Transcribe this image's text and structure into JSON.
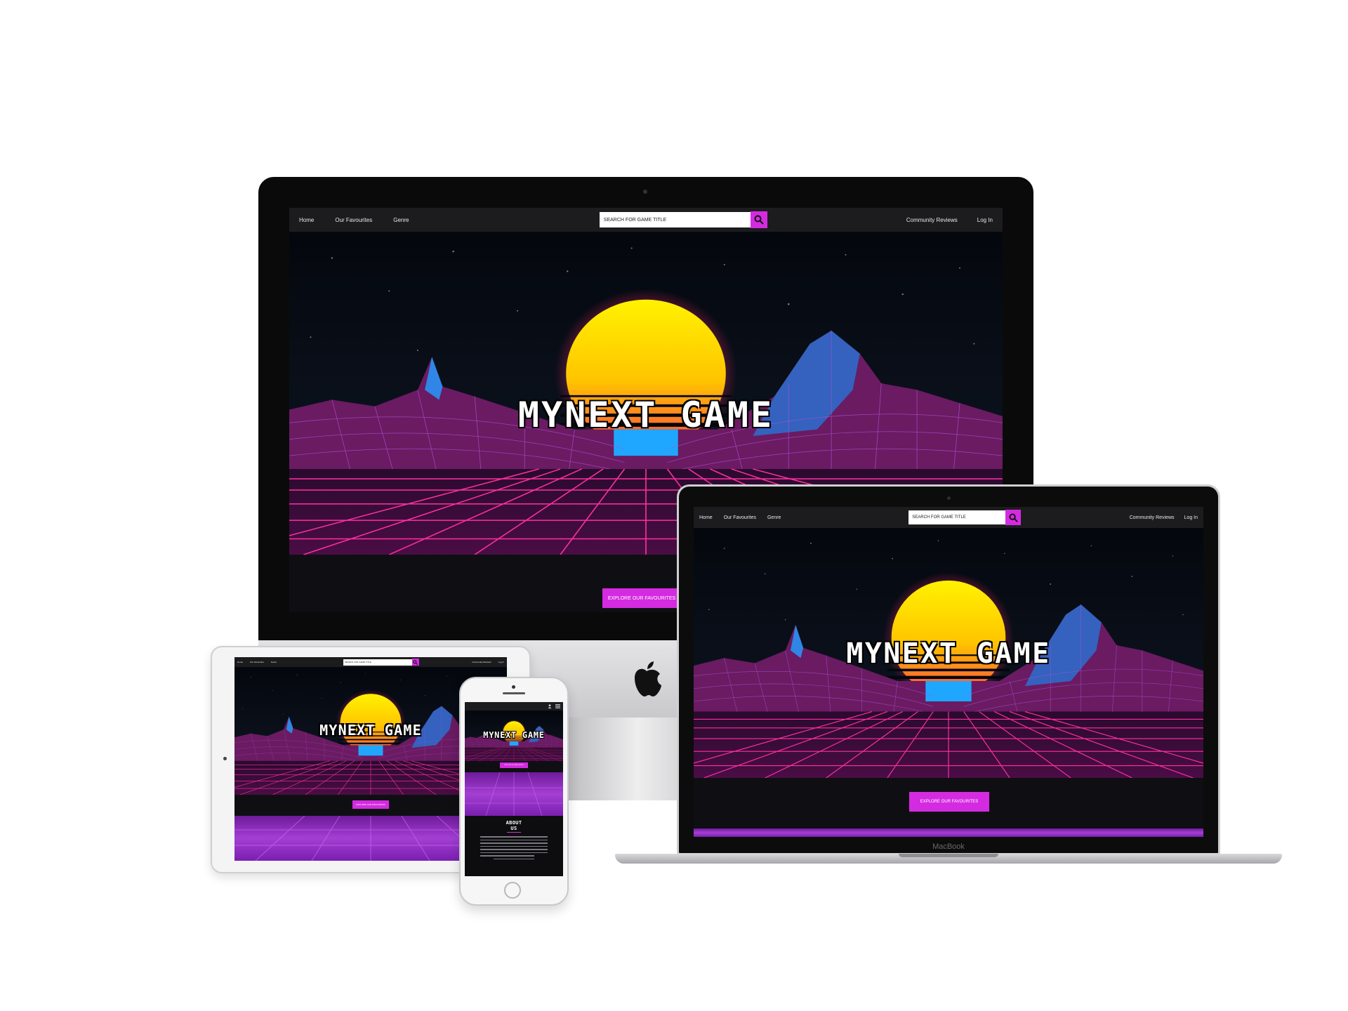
{
  "site": {
    "nav": {
      "home": "Home",
      "favourites": "Our Favourites",
      "genre": "Genre",
      "community": "Community Reviews",
      "login": "Log In"
    },
    "search": {
      "placeholder": "SEARCH FOR GAME TITLE"
    },
    "hero": {
      "title": "MYNEXT GAME"
    },
    "cta": "EXPLORE OUR FAVOURITES",
    "about": {
      "title_line1": "ABOUT",
      "title_line2": "US"
    }
  },
  "devices": {
    "laptop_brand": "MacBook"
  },
  "colors": {
    "accent": "#d42be0",
    "nav_bg": "#1c1c1f",
    "sun_top": "#ffee00",
    "sun_bottom": "#ff5a3c",
    "grid": "#ff2fa0",
    "mountain": "#7a1f6e",
    "mountain_blue": "#2a80e0"
  },
  "icons": [
    "search-icon",
    "apple-logo-icon",
    "user-icon",
    "menu-icon",
    "camera-icon",
    "home-button-icon"
  ]
}
